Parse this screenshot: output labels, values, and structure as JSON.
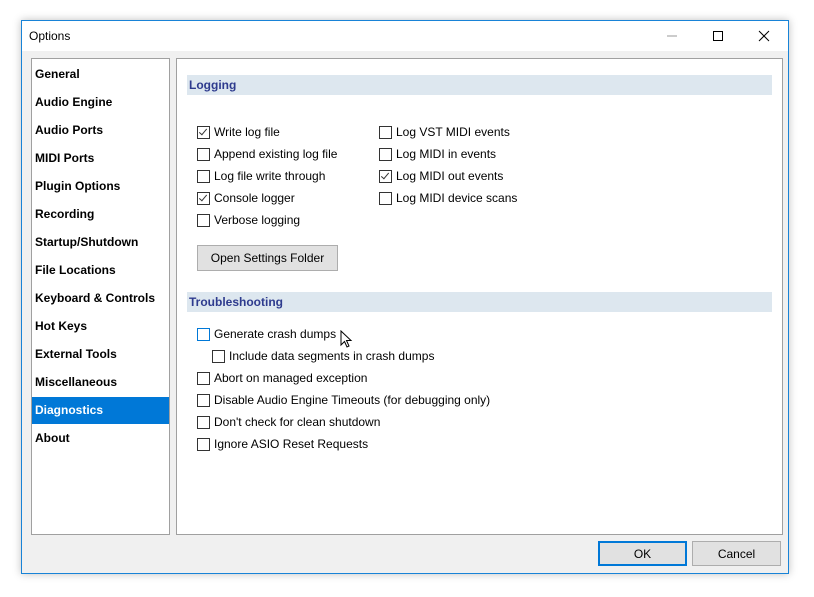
{
  "window": {
    "title": "Options"
  },
  "sidebar": {
    "items": [
      {
        "label": "General"
      },
      {
        "label": "Audio Engine"
      },
      {
        "label": "Audio Ports"
      },
      {
        "label": "MIDI Ports"
      },
      {
        "label": "Plugin Options"
      },
      {
        "label": "Recording"
      },
      {
        "label": "Startup/Shutdown"
      },
      {
        "label": "File Locations"
      },
      {
        "label": "Keyboard & Controls"
      },
      {
        "label": "Hot Keys"
      },
      {
        "label": "External Tools"
      },
      {
        "label": "Miscellaneous"
      },
      {
        "label": "Diagnostics",
        "selected": true
      },
      {
        "label": "About"
      }
    ]
  },
  "logging": {
    "header": "Logging",
    "left": [
      {
        "label": "Write log file",
        "checked": true
      },
      {
        "label": "Append existing log file",
        "checked": false
      },
      {
        "label": "Log file write through",
        "checked": false
      },
      {
        "label": "Console logger",
        "checked": true
      },
      {
        "label": "Verbose logging",
        "checked": false
      }
    ],
    "right": [
      {
        "label": "Log VST MIDI events",
        "checked": false
      },
      {
        "label": "Log MIDI in events",
        "checked": false
      },
      {
        "label": "Log MIDI out events",
        "checked": true
      },
      {
        "label": "Log MIDI device scans",
        "checked": false
      }
    ],
    "open_folder_label": "Open Settings Folder"
  },
  "troubleshooting": {
    "header": "Troubleshooting",
    "items": [
      {
        "label": "Generate crash dumps",
        "checked": false
      },
      {
        "label": "Include data segments in crash dumps",
        "checked": false
      },
      {
        "label": "Abort on managed exception",
        "checked": false
      },
      {
        "label": "Disable Audio Engine Timeouts (for debugging only)",
        "checked": false
      },
      {
        "label": "Don't check for clean shutdown",
        "checked": false
      },
      {
        "label": "Ignore ASIO Reset Requests",
        "checked": false
      }
    ]
  },
  "footer": {
    "ok_label": "OK",
    "cancel_label": "Cancel"
  },
  "colors": {
    "accent": "#0078d7",
    "section_bg": "#dde7ef",
    "section_text": "#2e3b8e"
  }
}
